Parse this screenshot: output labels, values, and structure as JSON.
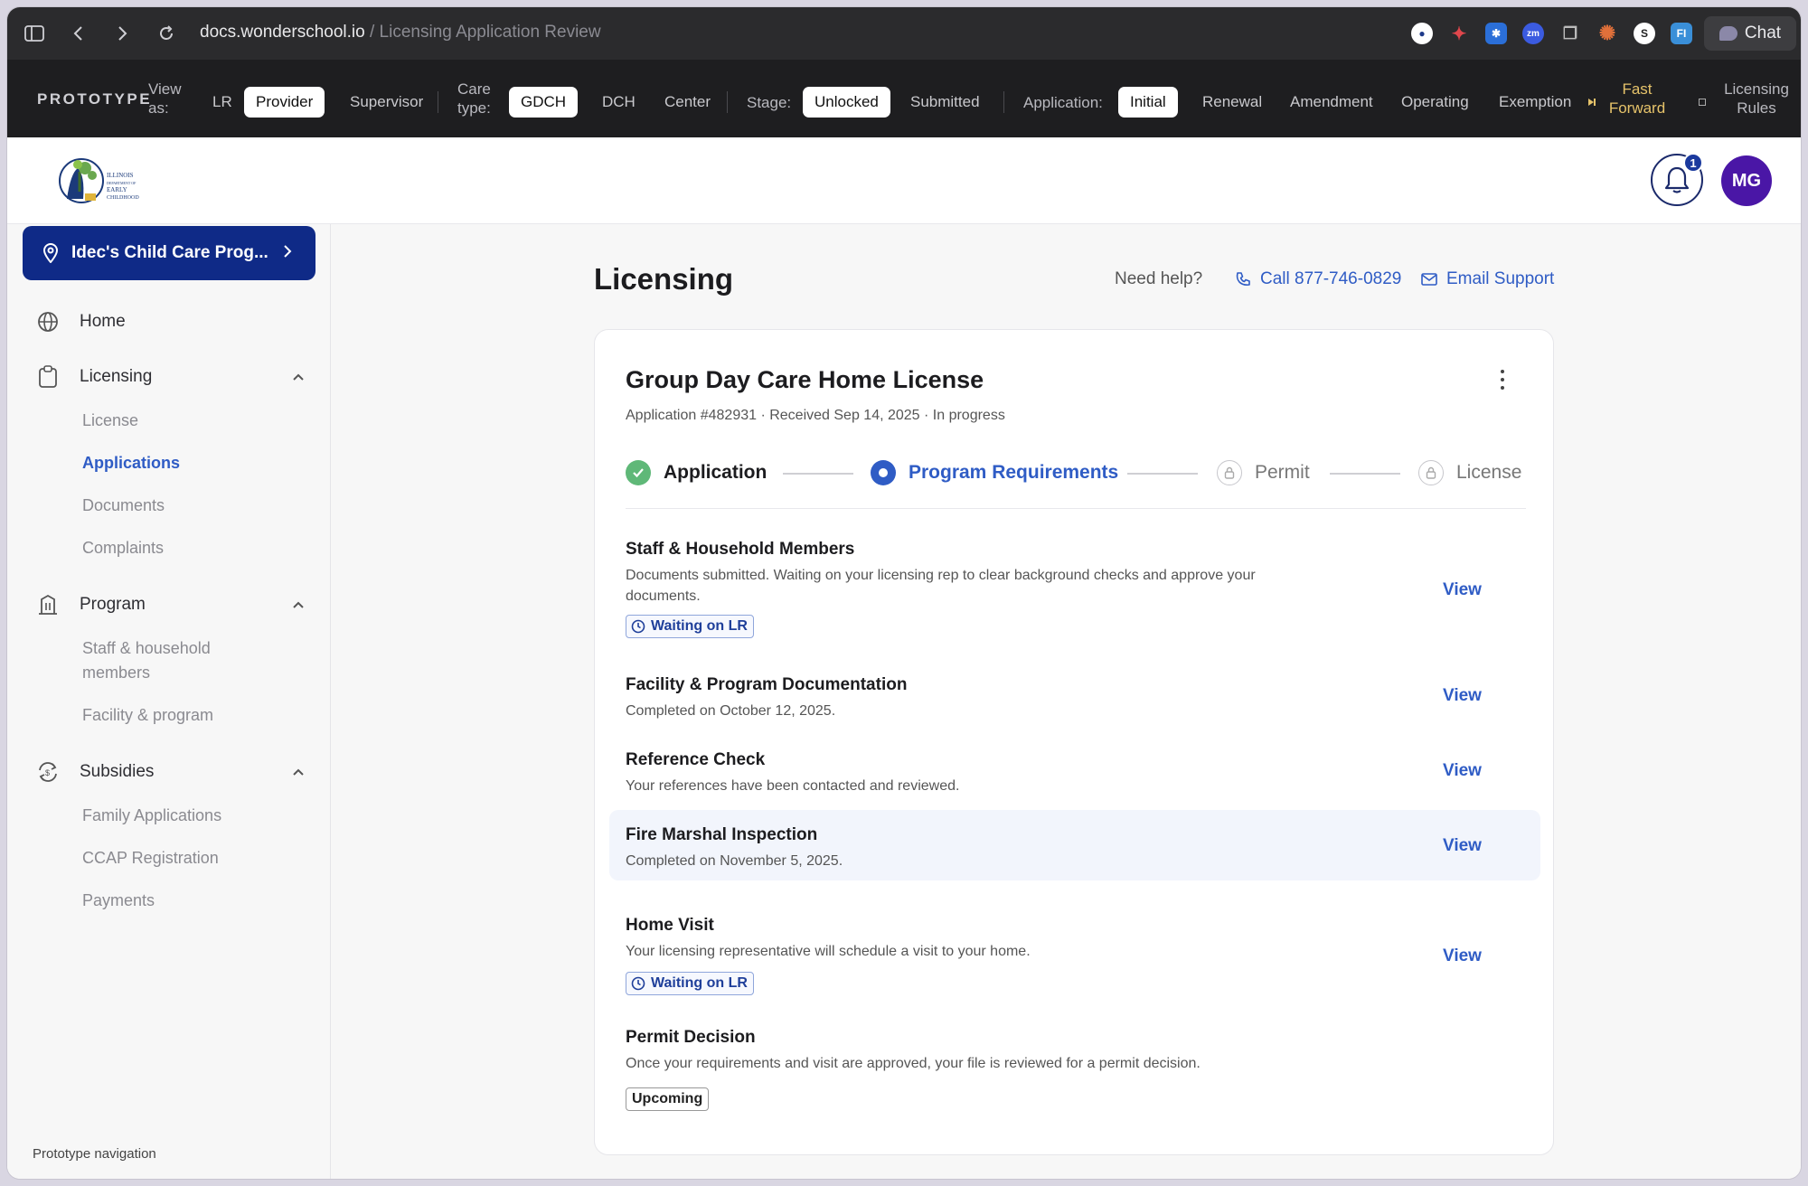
{
  "browser": {
    "url_domain": "docs.wonderschool.io",
    "url_path": " / Licensing Application Review",
    "chat_label": "Chat"
  },
  "prototype_bar": {
    "title": "PROTOTYPE",
    "view_as_label": "View as:",
    "view_as_options": [
      "LR",
      "Provider",
      "Supervisor"
    ],
    "view_as_selected": "Provider",
    "care_type_label": "Care type:",
    "care_type_options": [
      "GDCH",
      "DCH",
      "Center"
    ],
    "care_type_selected": "GDCH",
    "stage_label": "Stage:",
    "stage_options": [
      "Unlocked",
      "Submitted"
    ],
    "stage_selected": "Unlocked",
    "application_label": "Application:",
    "application_options": [
      "Initial",
      "Renewal",
      "Amendment",
      "Operating",
      "Exemption"
    ],
    "application_selected": "Initial",
    "fast_forward": "Fast Forward",
    "licensing_rules": "Licensing Rules"
  },
  "header": {
    "notification_count": "1",
    "avatar_initials": "MG"
  },
  "sidebar": {
    "program_selector": "Idec's Child Care Prog...",
    "home": "Home",
    "licensing": "Licensing",
    "licensing_items": [
      "License",
      "Applications",
      "Documents",
      "Complaints"
    ],
    "active_item": "Applications",
    "program": "Program",
    "program_items": [
      "Staff & household members",
      "Facility & program"
    ],
    "subsidies": "Subsidies",
    "subsidies_items": [
      "Family Applications",
      "CCAP Registration",
      "Payments"
    ],
    "prototype_navigation": "Prototype navigation"
  },
  "main": {
    "title": "Licensing",
    "need_help": "Need help?",
    "call": "Call 877-746-0829",
    "email": "Email Support",
    "card": {
      "title": "Group Day Care Home License",
      "subtitle": "Application #482931 · Received Sep 14, 2025 · In progress",
      "steps": [
        {
          "label": "Application",
          "state": "complete"
        },
        {
          "label": "Program Requirements",
          "state": "current"
        },
        {
          "label": "Permit",
          "state": "locked"
        },
        {
          "label": "License",
          "state": "locked"
        }
      ],
      "requirements": [
        {
          "title": "Staff & Household Members",
          "desc": "Documents submitted. Waiting on your licensing rep to clear background checks and approve your documents.",
          "badge": "Waiting on LR",
          "action": "View"
        },
        {
          "title": "Facility & Program Documentation",
          "desc": "Completed on October 12, 2025.",
          "action": "View"
        },
        {
          "title": "Reference Check",
          "desc": "Your references have been contacted and reviewed.",
          "action": "View"
        },
        {
          "title": "Fire Marshal Inspection",
          "desc": "Completed on November 5, 2025.",
          "action": "View"
        },
        {
          "title": "Home Visit",
          "desc": "Your licensing representative will schedule a visit to your home.",
          "badge": "Waiting on LR",
          "action": "View"
        },
        {
          "title": "Permit Decision",
          "desc": "Once your requirements and visit are approved, your file is reviewed for a permit decision.",
          "badge": "Upcoming"
        }
      ]
    }
  },
  "colors": {
    "accent": "#2f5cc5",
    "program_button": "#0f2a87",
    "avatar": "#4a16a6",
    "complete": "#5fb878"
  }
}
